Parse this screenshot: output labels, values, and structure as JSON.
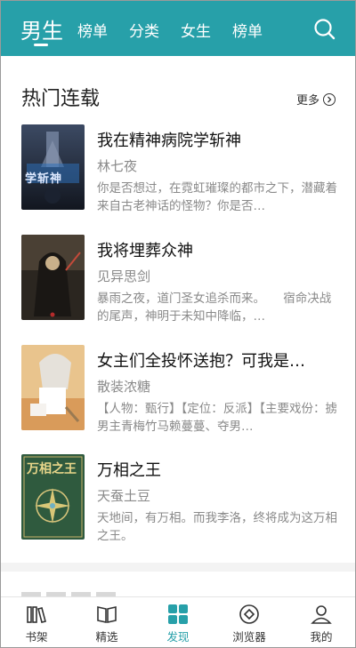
{
  "top_tabs": {
    "active": "男生",
    "items": [
      "榜单",
      "分类",
      "女生",
      "榜单"
    ]
  },
  "icons": {
    "search": "search-icon",
    "more": "chevron-right-circle-icon"
  },
  "colors": {
    "accent": "#27a0a9",
    "text_primary": "#111111",
    "text_secondary": "#8a8a8a"
  },
  "section": {
    "title": "热门连载",
    "more_label": "更多"
  },
  "books": [
    {
      "title": "我在精神病院学斩神",
      "author": "林七夜",
      "desc": "你是否想过，在霓虹璀璨的都市之下，潜藏着来自古老神话的怪物？你是否…",
      "cover_text": "学斩神"
    },
    {
      "title": "我将埋葬众神",
      "author": "见异思剑",
      "desc": "暴雨之夜，道门圣女追杀而来。　　宿命决战的尾声，神明于未知中降临，…",
      "cover_text": ""
    },
    {
      "title": "女主们全投怀送抱？可我是…",
      "author": "散装浓糖",
      "desc": "【人物：甄行】【定位：反派】【主要戏份：掳男主青梅竹马赖蔓蔓、夺男…",
      "cover_text": ""
    },
    {
      "title": "万相之王",
      "author": "天蚕土豆",
      "desc": "天地间，有万相。而我李洛，终将成为这万相之王。",
      "cover_text": "万相之王"
    }
  ],
  "bottom_nav": [
    {
      "label": "书架",
      "icon": "bookshelf-icon",
      "active": false
    },
    {
      "label": "精选",
      "icon": "open-book-icon",
      "active": false
    },
    {
      "label": "发现",
      "icon": "grid-icon",
      "active": true
    },
    {
      "label": "浏览器",
      "icon": "compass-icon",
      "active": false
    },
    {
      "label": "我的",
      "icon": "user-icon",
      "active": false
    }
  ]
}
